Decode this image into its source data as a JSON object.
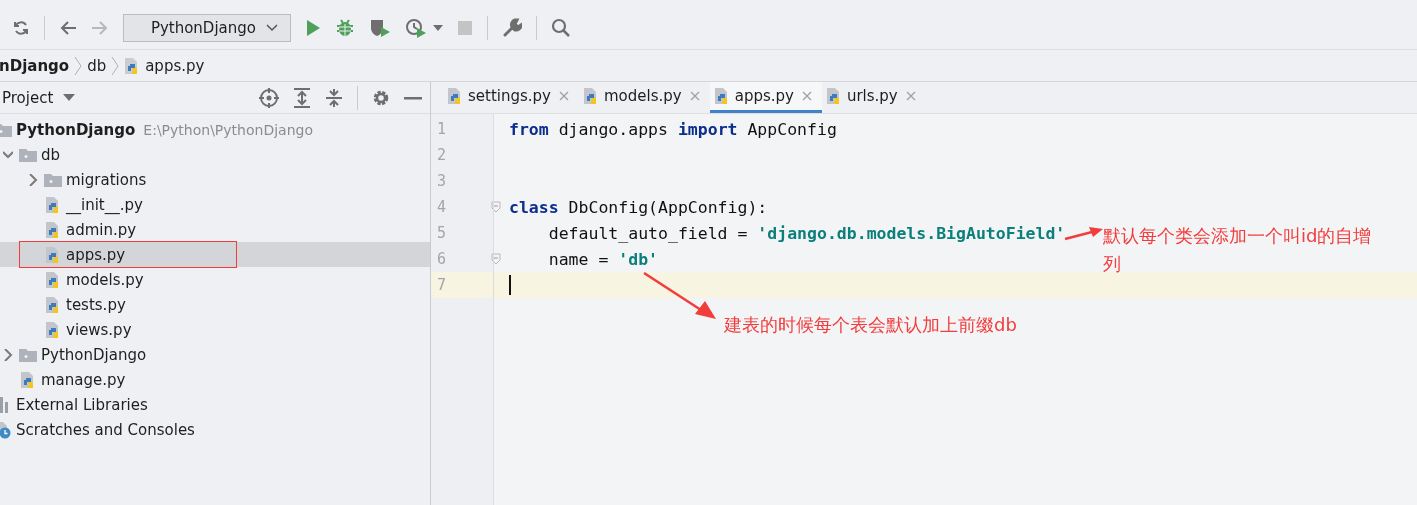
{
  "toolbar": {
    "run_config": "PythonDjango"
  },
  "breadcrumbs": [
    "nDjango",
    "db",
    "apps.py"
  ],
  "project_panel": {
    "title": "Project",
    "tree": [
      {
        "label": "PythonDjango",
        "kind": "root",
        "path": "E:\\Python\\PythonDjango",
        "selected": false,
        "children": [
          {
            "label": "db",
            "kind": "folder",
            "expanded": true,
            "selected": false,
            "children": [
              {
                "label": "migrations",
                "kind": "folder",
                "expanded": false,
                "selected": false
              },
              {
                "label": "__init__.py",
                "kind": "file",
                "selected": false
              },
              {
                "label": "admin.py",
                "kind": "file",
                "selected": false
              },
              {
                "label": "apps.py",
                "kind": "file",
                "selected": true
              },
              {
                "label": "models.py",
                "kind": "file",
                "selected": false
              },
              {
                "label": "tests.py",
                "kind": "file",
                "selected": false
              },
              {
                "label": "views.py",
                "kind": "file",
                "selected": false
              }
            ]
          },
          {
            "label": "PythonDjango",
            "kind": "folder",
            "expanded": false,
            "selected": false
          },
          {
            "label": "manage.py",
            "kind": "file",
            "selected": false
          }
        ]
      },
      {
        "label": "External Libraries",
        "kind": "library",
        "selected": false
      },
      {
        "label": "Scratches and Consoles",
        "kind": "scratches",
        "selected": false
      }
    ]
  },
  "tabs": [
    {
      "label": "settings.py",
      "selected": false
    },
    {
      "label": "models.py",
      "selected": false
    },
    {
      "label": "apps.py",
      "selected": true
    },
    {
      "label": "urls.py",
      "selected": false
    }
  ],
  "editor": {
    "lines": [
      {
        "number": "1",
        "current": false,
        "tokens": [
          {
            "kind": "keyword",
            "text": "from"
          },
          {
            "kind": "plain",
            "text": " django.apps "
          },
          {
            "kind": "keyword",
            "text": "import"
          },
          {
            "kind": "plain",
            "text": " AppConfig"
          }
        ]
      },
      {
        "number": "2",
        "current": false
      },
      {
        "number": "3",
        "current": false
      },
      {
        "number": "4",
        "current": false,
        "fold": true,
        "tokens": [
          {
            "kind": "keyword",
            "text": "class"
          },
          {
            "kind": "plain",
            "text": " DbConfig(AppConfig):"
          }
        ]
      },
      {
        "number": "5",
        "current": false,
        "tokens": [
          {
            "kind": "plain",
            "text": "    default_auto_field = "
          },
          {
            "kind": "string",
            "text": "'django.db.models.BigAutoField'"
          }
        ]
      },
      {
        "number": "6",
        "current": false,
        "fold": true,
        "tokens": [
          {
            "kind": "plain",
            "text": "    name = "
          },
          {
            "kind": "string",
            "text": "'db'"
          }
        ]
      },
      {
        "number": "7",
        "current": true
      }
    ]
  },
  "annotations": [
    "默认每个类会添加一个叫id的自增列",
    "建表的时候每个表会默认加上前缀db"
  ]
}
